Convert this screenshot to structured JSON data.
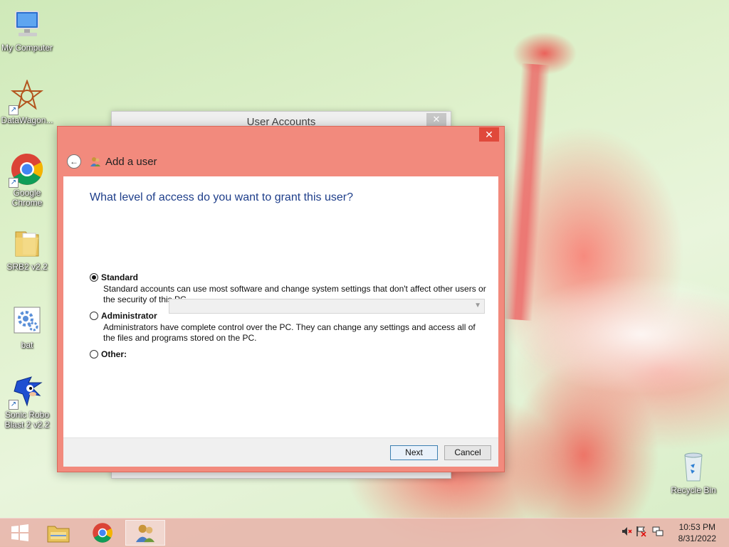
{
  "desktop": {
    "icons": [
      {
        "label": "My Computer"
      },
      {
        "label": "DataWagon..."
      },
      {
        "label": "Google Chrome"
      },
      {
        "label": "SRB2 v2.2"
      },
      {
        "label": "bat"
      },
      {
        "label": "Sonic Robo Blast 2 v2.2"
      },
      {
        "label": "Recycle Bin"
      }
    ]
  },
  "background_window": {
    "title": "User Accounts",
    "close_glyph": "✕"
  },
  "dialog": {
    "close_glyph": "✕",
    "back_glyph": "←",
    "title": "Add a user",
    "question": "What level of access do you want to grant this user?",
    "options": [
      {
        "label": "Standard",
        "selected": true,
        "description": "Standard accounts can use most software and change system settings that don't affect other users or the security of this PC."
      },
      {
        "label": "Administrator",
        "selected": false,
        "description": "Administrators have complete control over the PC. They can change any settings and access all of the files and programs stored on the PC."
      },
      {
        "label": "Other:",
        "selected": false
      }
    ],
    "other_select_value": "",
    "next_label": "Next",
    "cancel_label": "Cancel"
  },
  "taskbar": {
    "items": [
      "start-button",
      "file-explorer",
      "google-chrome",
      "user-accounts"
    ],
    "tray_icons": [
      "volume-muted-icon",
      "action-center-flag-icon",
      "network-icon"
    ],
    "time": "10:53 PM",
    "date": "8/31/2022"
  },
  "colors": {
    "accent": "#f28a7d",
    "close": "#e0493b",
    "heading": "#1e3e8a"
  }
}
